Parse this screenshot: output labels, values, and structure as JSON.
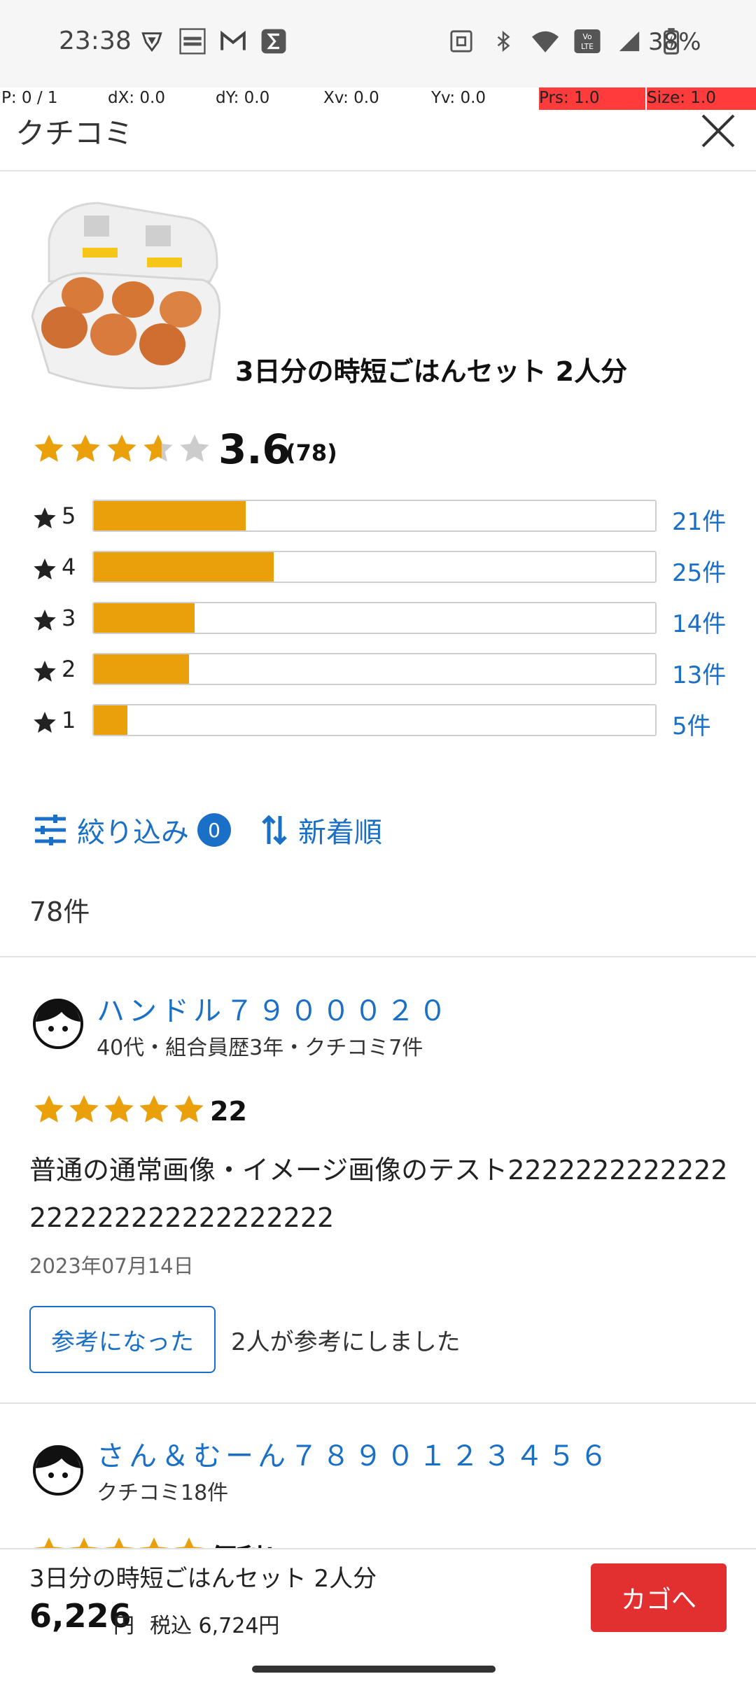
{
  "status_bar": {
    "time": "23:38",
    "battery_percent": "38%",
    "left_icons": [
      "vpn-shield-icon",
      "sports-bull-app-icon",
      "gmail-icon",
      "sigma-app-icon"
    ],
    "right_icons": [
      "nfc-icon",
      "bluetooth-icon",
      "wifi-icon",
      "volte-icon",
      "signal-icon",
      "battery-charging-icon"
    ]
  },
  "debug_overlay": {
    "p": "P: 0 / 1",
    "dx": "dX: 0.0",
    "dy": "dY: 0.0",
    "xv": "Xv: 0.0",
    "yv": "Yv: 0.0",
    "prs": "Prs: 1.0",
    "size": "Size: 1.0",
    "highlight_color": "#ff3b3b"
  },
  "header": {
    "title": "クチコミ",
    "close_icon": "close-icon"
  },
  "product": {
    "name": "3日分の時短ごはんセット 2人分",
    "image": "egg-carton-image"
  },
  "rating_summary": {
    "average": "3.6",
    "count": "(78)",
    "average_value": 3.6,
    "star_color": "#e9a00a",
    "empty_star_color": "#cccccc",
    "distribution": [
      {
        "stars": "5",
        "count": "21件",
        "fraction": 0.27
      },
      {
        "stars": "4",
        "count": "25件",
        "fraction": 0.32
      },
      {
        "stars": "3",
        "count": "14件",
        "fraction": 0.18
      },
      {
        "stars": "2",
        "count": "13件",
        "fraction": 0.17
      },
      {
        "stars": "1",
        "count": "5件",
        "fraction": 0.06
      }
    ]
  },
  "controls": {
    "filter_label": "絞り込み",
    "filter_count": "0",
    "sort_label": "新着順",
    "accent_color": "#1a6fc7"
  },
  "total_count": "78件",
  "reviews": [
    {
      "name": "ハンドル７９０００２０",
      "meta": "40代・組合員歴3年・クチコミ7件",
      "rating": 5,
      "title": "22",
      "body": "普通の通常画像・イメージ画像のテスト2222222222222222222222222222222",
      "date": "2023年07月14日",
      "helpful_button": "参考になった",
      "helpful_text": "2人が参考にしました"
    },
    {
      "name": "さん＆むーん７８９０１２３４５６",
      "meta": "クチコミ18件",
      "rating": 5,
      "title": "便利！"
    }
  ],
  "bottom_bar": {
    "product_name": "3日分の時短ごはんセット 2人分",
    "price": "6,226",
    "yen": "円",
    "tax_included": "税込 6,724円",
    "cart_button": "カゴへ",
    "cart_color": "#e23030"
  }
}
